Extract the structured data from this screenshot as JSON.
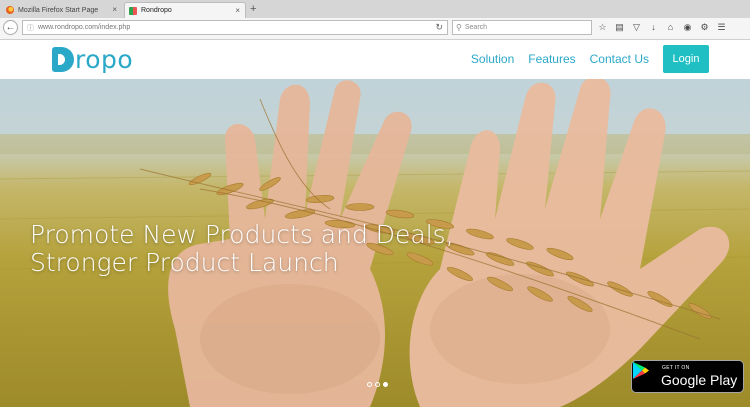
{
  "browser": {
    "tabs": [
      {
        "title": "Mozilla Firefox Start Page"
      },
      {
        "title": "Rondropo"
      }
    ],
    "new_tab_label": "+",
    "tab_close_label": "×",
    "url": "www.rondropo.com/index.php",
    "search_placeholder": "Search"
  },
  "site": {
    "logo_text": "ropo",
    "nav": {
      "links": [
        "Solution",
        "Features",
        "Contact Us"
      ],
      "login_label": "Login"
    },
    "hero": {
      "headline_line1": "Promote New Products and Deals,",
      "headline_line2": "Stronger Product Launch",
      "carousel_active_index": 2,
      "badge_small": "GET IT ON",
      "badge_big": "Google Play"
    }
  },
  "colors": {
    "brand": "#2aa8c8",
    "login_bg": "#1fbfc3"
  },
  "icons": [
    "back-arrow-icon",
    "info-icon",
    "reload-icon",
    "search-icon",
    "star-icon",
    "reading-list-icon",
    "pocket-icon",
    "download-icon",
    "home-icon",
    "chat-icon",
    "extension-icon",
    "menu-icon",
    "google-play-icon"
  ]
}
